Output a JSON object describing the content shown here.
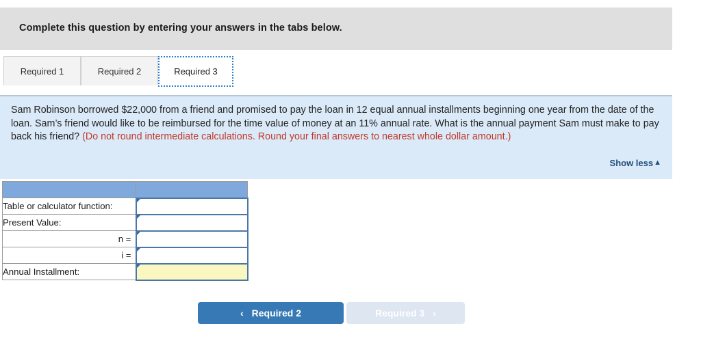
{
  "banner": {
    "instruction": "Complete this question by entering your answers in the tabs below."
  },
  "tabs": [
    {
      "label": "Required 1",
      "active": false
    },
    {
      "label": "Required 2",
      "active": false
    },
    {
      "label": "Required 3",
      "active": true
    }
  ],
  "question": {
    "body": "Sam Robinson borrowed $22,000 from a friend and promised to pay the loan in 12 equal annual installments beginning one year from the date of the loan. Sam’s friend would like to be reimbursed for the time value of money at an 11% annual rate. What is the annual payment Sam must make to pay back his friend? ",
    "emphasis": "(Do not round intermediate calculations. Round your final answers to nearest whole dollar amount.)",
    "emphasis_color": "#c0392b",
    "show_less_label": "Show less",
    "show_less_caret": "▲",
    "panel_color": "#dbeaf8"
  },
  "answer_table": {
    "header_color": "#7fa9dc",
    "highlight_color": "#faf8c0",
    "header": {
      "label_col": "",
      "input_col": ""
    },
    "rows": [
      {
        "label": "Table or calculator function:",
        "align": "left",
        "value": "",
        "highlight": false
      },
      {
        "label": "Present Value:",
        "align": "left",
        "value": "",
        "highlight": false
      },
      {
        "label": "n =",
        "align": "right",
        "value": "",
        "highlight": false
      },
      {
        "label": "i =",
        "align": "right",
        "value": "",
        "highlight": false
      },
      {
        "label": "Annual Installment:",
        "align": "left",
        "value": "",
        "highlight": true
      }
    ]
  },
  "nav": {
    "prev": {
      "label": "Required 2",
      "icon": "‹",
      "enabled": true,
      "color": "#3679b5"
    },
    "next": {
      "label": "Required 3",
      "icon": "›",
      "enabled": false,
      "color": "#dde6f1"
    }
  }
}
